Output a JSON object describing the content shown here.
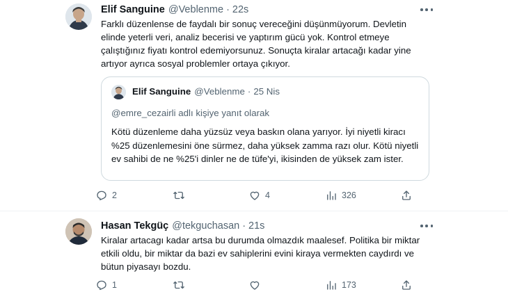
{
  "tweets": [
    {
      "name": "Elif Sanguine",
      "handle": "@Veblenme",
      "dot": "·",
      "time": "22s",
      "avatar_icon": "avatar-elif",
      "text": "Farklı düzenlense de faydalı bir sonuç vereceğini düşünmüyorum. Devletin elinde yeterli veri, analiz becerisi ve yaptırım gücü yok. Kontrol etmeye çalıştığınız fiyatı kontrol edemiyorsunuz. Sonuçta kiralar artacağı kadar yine artıyor ayrıca sosyal problemler ortaya çıkıyor.",
      "quote": {
        "name": "Elif Sanguine",
        "handle": "@Veblenme",
        "dot": "·",
        "date": "25 Nis",
        "reply_context": "@emre_cezairli adlı kişiye yanıt olarak",
        "text": "Kötü düzenleme daha yüzsüz veya baskın olana yarıyor. İyi niyetli kiracı %25 düzenlemesini öne sürmez, daha yüksek zamma razı olur. Kötü niyetli ev sahibi de ne %25'i dinler ne de tüfe'yi, ikisinden de yüksek zam ister."
      },
      "actions": {
        "replies": "2",
        "retweets": "",
        "likes": "4",
        "views": "326"
      }
    },
    {
      "name": "Hasan Tekgüç",
      "handle": "@tekguchasan",
      "dot": "·",
      "time": "21s",
      "avatar_icon": "avatar-hasan",
      "text": "Kiralar artacagı kadar artsa bu durumda olmazdık maalesef. Politika bir miktar etkili oldu, bir miktar da bazi ev sahiplerini evini kiraya vermekten caydırdı ve bütun piyasayı bozdu.",
      "actions": {
        "replies": "1",
        "retweets": "",
        "likes": "",
        "views": "173"
      }
    }
  ],
  "colors": {
    "text": "#0f1419",
    "muted": "#536471",
    "border": "#cfd9de",
    "divider": "#eff3f4"
  },
  "icons": [
    "reply-icon",
    "retweet-icon",
    "like-icon",
    "views-icon",
    "share-icon",
    "more-icon"
  ]
}
